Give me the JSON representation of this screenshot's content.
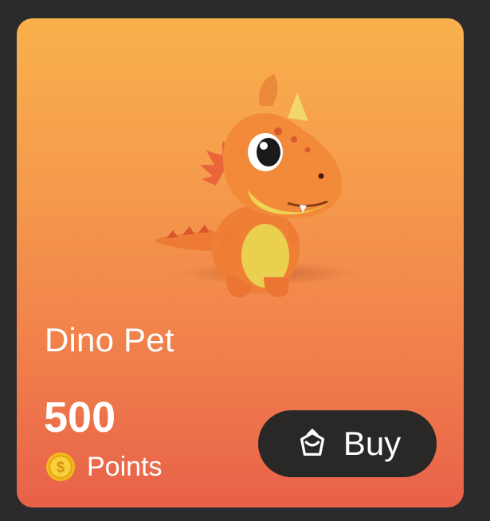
{
  "card": {
    "title": "Dino Pet",
    "price": "500",
    "currency_label": "Points",
    "buy_label": "Buy"
  },
  "icons": {
    "pet_image": "orange-dinosaur-illustration",
    "coin": "gold-coin-icon",
    "buy": "shopping-bag-icon"
  },
  "colors": {
    "gradient_top": "#f9b14c",
    "gradient_bottom": "#e8614a",
    "button_bg": "#2a2727",
    "text": "#ffffff",
    "coin": "#f6c21c"
  }
}
